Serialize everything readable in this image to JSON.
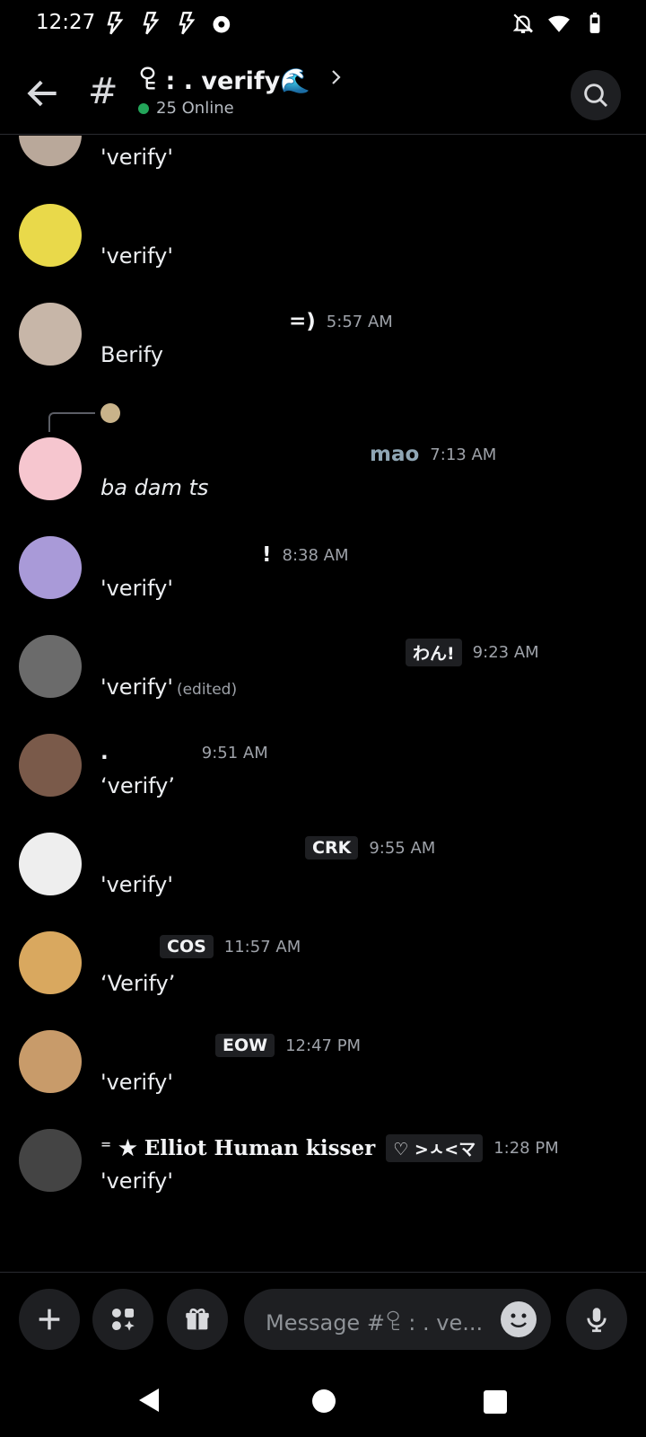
{
  "status_bar": {
    "time": "12:27",
    "left_icons": [
      "bolt-icon",
      "bolt-icon",
      "bolt-icon",
      "record-icon"
    ],
    "right_icons": [
      "bell-off-icon",
      "wifi-icon",
      "battery-icon"
    ]
  },
  "header": {
    "hash": "#",
    "channel_name": "ꄗ : . verify🌊",
    "online_count": "25 Online",
    "online_color": "#23a55a"
  },
  "messages": [
    {
      "author": "",
      "tag": "",
      "time": "",
      "content": "'verify'",
      "edited": "",
      "avatar_color": "#b9a89a"
    },
    {
      "author": "",
      "tag": "",
      "time": "",
      "content": "'verify'",
      "edited": "",
      "avatar_color": "#e9d94a"
    },
    {
      "author": "=)",
      "tag": "",
      "time": "5:57 AM",
      "content": "Berify",
      "edited": "",
      "avatar_color": "#c7b6a8"
    },
    {
      "author": "mao",
      "tag": "",
      "time": "7:13 AM",
      "content": "ba dam ts",
      "edited": "",
      "avatar_color": "#f6c6cf"
    },
    {
      "author": "!",
      "tag": "",
      "time": "8:38 AM",
      "content": "'verify'",
      "edited": "",
      "avatar_color": "#a99ad8"
    },
    {
      "author": "",
      "tag": "わん!",
      "time": "9:23 AM",
      "content": "'verify'",
      "edited": "(edited)",
      "avatar_color": "#6b6b6b"
    },
    {
      "author": ".",
      "tag": "",
      "time": "9:51 AM",
      "content": "‘verify’",
      "edited": "",
      "avatar_color": "#7a5a4a"
    },
    {
      "author": "",
      "tag": "CRK",
      "time": "9:55 AM",
      "content": "'verify'",
      "edited": "",
      "avatar_color": "#eeeeee"
    },
    {
      "author": "",
      "tag": "COS",
      "time": "11:57 AM",
      "content": "‘Verify’",
      "edited": "",
      "avatar_color": "#d9a85f"
    },
    {
      "author": "",
      "tag": "EOW",
      "time": "12:47 PM",
      "content": "'verify'",
      "edited": "",
      "avatar_color": "#c89b6a"
    },
    {
      "author": "⁼ ★ Elliot Human kisser",
      "tag": "♡ >ㅅ<マ",
      "time": "1:28 PM",
      "content": "'verify'",
      "edited": "",
      "avatar_color": "#444444"
    }
  ],
  "composer": {
    "placeholder": "Message #ꄗ : . ve...",
    "buttons": [
      "plus-icon",
      "apps-icon",
      "gift-icon",
      "mic-icon"
    ]
  }
}
